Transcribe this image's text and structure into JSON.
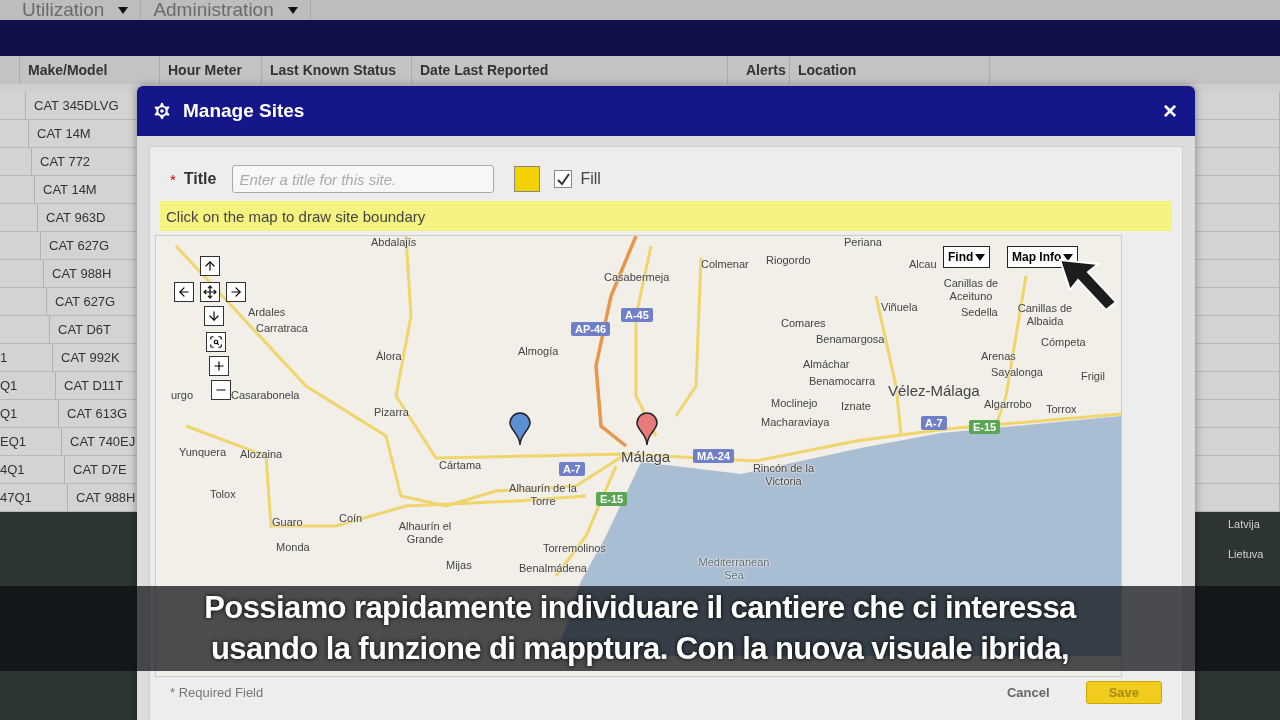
{
  "nav": {
    "tabs": [
      {
        "label": "Utilization"
      },
      {
        "label": "Administration"
      }
    ]
  },
  "table": {
    "columns": [
      "Make/Model",
      "Hour Meter",
      "Last Known Status",
      "Date Last Reported",
      "Alerts",
      "Location"
    ],
    "rows": [
      {
        "make_model": "CAT 345DLVG"
      },
      {
        "make_model": "CAT 14M"
      },
      {
        "make_model": "CAT 772"
      },
      {
        "make_model": "CAT 14M"
      },
      {
        "make_model": "CAT 963D"
      },
      {
        "make_model": "CAT 627G"
      },
      {
        "make_model": "CAT 988H"
      },
      {
        "make_model": "CAT 627G"
      },
      {
        "make_model": "CAT D6T"
      },
      {
        "column_1": "1",
        "make_model": "CAT 992K"
      },
      {
        "column_1": "Q1",
        "make_model": "CAT D11T"
      },
      {
        "column_1": "Q1",
        "make_model": "CAT 613G"
      },
      {
        "column_1": "EQ1",
        "make_model": "CAT 740EJ"
      },
      {
        "column_1": "4Q1",
        "make_model": "CAT D7E"
      },
      {
        "column_1": "47Q1",
        "make_model": "CAT 988H"
      }
    ]
  },
  "dialog": {
    "title": "Manage Sites",
    "close": "×",
    "title_field": {
      "required_mark": "*",
      "label": "Title",
      "placeholder": "Enter a title for this site."
    },
    "color_swatch": {
      "color": "#f2d200"
    },
    "fill": {
      "label": "Fill",
      "checked": true
    },
    "hint": "Click on the map to draw site boundary",
    "map": {
      "buttons": [
        {
          "label": "Find"
        },
        {
          "label": "Map Info"
        }
      ],
      "labels": [
        {
          "text": "Abdalajís",
          "kind": "town"
        },
        {
          "text": "Ardales",
          "kind": "town"
        },
        {
          "text": "Carratraca",
          "kind": "town"
        },
        {
          "text": "Álora",
          "kind": "town"
        },
        {
          "text": "Almogía",
          "kind": "town"
        },
        {
          "text": "urgo",
          "kind": "town"
        },
        {
          "text": "Casarabonela",
          "kind": "town"
        },
        {
          "text": "Pizarra",
          "kind": "town"
        },
        {
          "text": "Yunquera",
          "kind": "town"
        },
        {
          "text": "Alozaina",
          "kind": "town"
        },
        {
          "text": "Cártama",
          "kind": "town"
        },
        {
          "text": "Tolox",
          "kind": "town"
        },
        {
          "text": "Alhaurín de la Torre",
          "kind": "town"
        },
        {
          "text": "Guaro",
          "kind": "town"
        },
        {
          "text": "Coín",
          "kind": "town"
        },
        {
          "text": "Alhaurín el Grande",
          "kind": "town"
        },
        {
          "text": "Monda",
          "kind": "town"
        },
        {
          "text": "Torremolinos",
          "kind": "town"
        },
        {
          "text": "Mijas",
          "kind": "town"
        },
        {
          "text": "Benalmádena",
          "kind": "town"
        },
        {
          "text": "Casabermeja",
          "kind": "town"
        },
        {
          "text": "Periana",
          "kind": "town"
        },
        {
          "text": "Colmenar",
          "kind": "town"
        },
        {
          "text": "Riogordo",
          "kind": "town"
        },
        {
          "text": "Alcau",
          "kind": "town"
        },
        {
          "text": "Canillas de Aceituno",
          "kind": "town"
        },
        {
          "text": "Viñuela",
          "kind": "town"
        },
        {
          "text": "Sedella",
          "kind": "town"
        },
        {
          "text": "Canillas de Albaida",
          "kind": "town"
        },
        {
          "text": "Cómpeta",
          "kind": "town"
        },
        {
          "text": "Comares",
          "kind": "town"
        },
        {
          "text": "Benamargosa",
          "kind": "town"
        },
        {
          "text": "Almáchar",
          "kind": "town"
        },
        {
          "text": "Benamocarra",
          "kind": "town"
        },
        {
          "text": "Arenas",
          "kind": "town"
        },
        {
          "text": "Sayalonga",
          "kind": "town"
        },
        {
          "text": "Frigil",
          "kind": "town"
        },
        {
          "text": "Vélez-Málaga",
          "kind": "city"
        },
        {
          "text": "Moclinejo",
          "kind": "town"
        },
        {
          "text": "Iznate",
          "kind": "town"
        },
        {
          "text": "Algarrobo",
          "kind": "town"
        },
        {
          "text": "Torrox",
          "kind": "town"
        },
        {
          "text": "Macharaviaya",
          "kind": "town"
        },
        {
          "text": "Málaga",
          "kind": "city"
        },
        {
          "text": "Rincón de la Victoria",
          "kind": "town"
        },
        {
          "text": "Mediterranean Sea",
          "kind": "sea"
        }
      ],
      "road_shields": [
        {
          "text": "AP-46",
          "kind": "national"
        },
        {
          "text": "A-45",
          "kind": "national"
        },
        {
          "text": "A-7",
          "kind": "national"
        },
        {
          "text": "E-15",
          "kind": "european"
        },
        {
          "text": "MA-24",
          "kind": "national"
        },
        {
          "text": "A-7",
          "kind": "national"
        },
        {
          "text": "E-15",
          "kind": "european"
        }
      ]
    },
    "required_note": {
      "mark": "*",
      "text": "Required Field"
    },
    "actions": [
      {
        "label": "Cancel",
        "kind": "secondary"
      },
      {
        "label": "Save",
        "kind": "primary"
      }
    ]
  },
  "background_map": {
    "labels": [
      "Latvija",
      "Lietuva"
    ]
  },
  "subtitle": [
    "Possiamo rapidamente individuare il cantiere che ci interessa",
    "usando la funzione di mapptura. Con la nuova visuale ibrida,"
  ]
}
